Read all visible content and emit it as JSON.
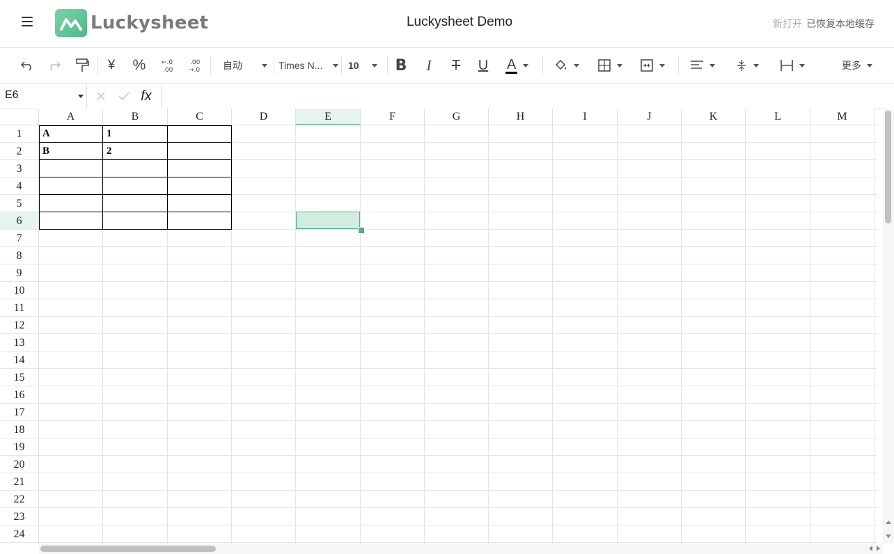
{
  "header": {
    "app_name": "Luckysheet",
    "title": "Luckysheet Demo",
    "sync_open": "新打开",
    "sync_status": "已恢复本地缓存"
  },
  "toolbar": {
    "format_label": "自动",
    "font_name": "Times N...",
    "font_size": "10",
    "currency_symbol": "¥",
    "percent_symbol": "%",
    "more_label": "更多",
    "text_color_accent": "#000000"
  },
  "formula_bar": {
    "cell_ref": "E6",
    "fx_label": "fx",
    "value": ""
  },
  "grid": {
    "columns": [
      "A",
      "B",
      "C",
      "D",
      "E",
      "F",
      "G",
      "H",
      "I",
      "J",
      "K",
      "L",
      "M"
    ],
    "rows": [
      "1",
      "2",
      "3",
      "4",
      "5",
      "6",
      "7",
      "8",
      "9",
      "10",
      "11",
      "12",
      "13",
      "14",
      "15",
      "16",
      "17",
      "18",
      "19",
      "20",
      "21",
      "22",
      "23",
      "24"
    ],
    "selected_column": "E",
    "selected_row": "6",
    "cells": [
      {
        "ref": "A1",
        "value": "A"
      },
      {
        "ref": "B1",
        "value": "1"
      },
      {
        "ref": "A2",
        "value": "B"
      },
      {
        "ref": "B2",
        "value": "2"
      }
    ]
  },
  "colors": {
    "accent": "#4fae84",
    "selection_fill": "#cfe8dc"
  }
}
